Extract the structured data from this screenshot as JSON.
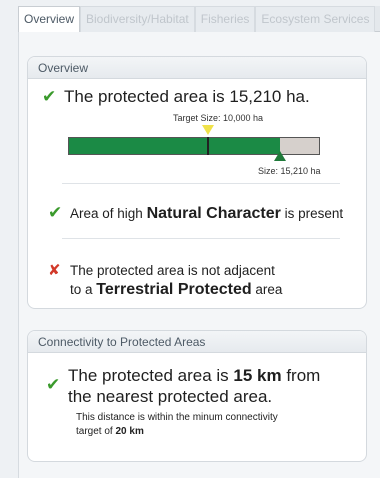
{
  "tabs": [
    {
      "label": "Overview",
      "active": true
    },
    {
      "label": "Biodiversity/Habitat",
      "active": false
    },
    {
      "label": "Fisheries",
      "active": false
    },
    {
      "label": "Ecosystem Services",
      "active": false
    }
  ],
  "overview": {
    "header": "Overview",
    "area_text": "The protected area is 15,210 ha.",
    "target_label": "Target Size: 10,000 ha",
    "size_label": "Size: 15,210 ha",
    "size_ha": 15210,
    "target_ha": 10000,
    "scale_max_ha": 18000,
    "natural_pre": "Area of high",
    "natural_strong": "Natural Character",
    "natural_post": "is present",
    "terr_line1": "The protected area is not adjacent",
    "terr_pre": "to a",
    "terr_strong": "Terrestrial Protected",
    "terr_post": "area"
  },
  "connectivity": {
    "header": "Connectivity to Protected Areas",
    "line_pre": "The protected area is",
    "distance": "15 km",
    "line_post": "from",
    "line2": "the nearest protected area.",
    "note_line1": "This distance is within the minum connectivity",
    "note_pre": "target of",
    "note_strong": "20 km"
  },
  "colors": {
    "check": "#3a9a2c",
    "cross": "#d23a2a",
    "bar_fill": "#1b8a45",
    "target_marker": "#f0e24a",
    "size_marker": "#1f7a3a"
  }
}
